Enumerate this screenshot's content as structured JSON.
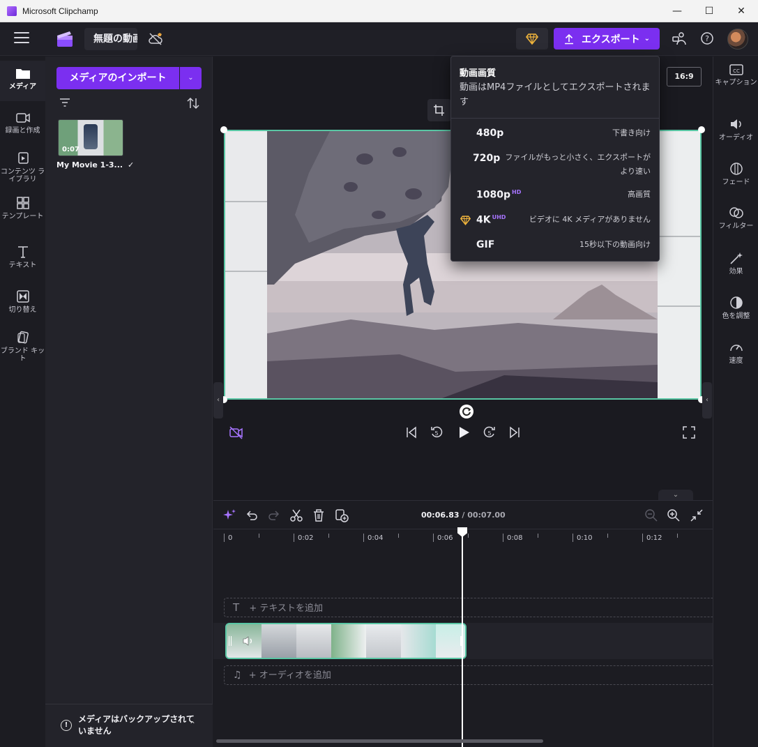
{
  "window": {
    "title": "Microsoft Clipchamp",
    "minimize": "—",
    "maximize": "☐",
    "close": "✕"
  },
  "appbar": {
    "project_name": "無題の動画",
    "export_label": "エクスポート"
  },
  "left_rail": [
    {
      "name": "media",
      "label": "メディア"
    },
    {
      "name": "record",
      "label": "録画と作成"
    },
    {
      "name": "content-library",
      "label": "コンテンツ ライブラリ"
    },
    {
      "name": "templates",
      "label": "テンプレート"
    },
    {
      "name": "text",
      "label": "テキスト"
    },
    {
      "name": "transitions",
      "label": "切り替え"
    },
    {
      "name": "brand-kit",
      "label": "ブランド キット"
    }
  ],
  "media_panel": {
    "import_label": "メディアのインポート",
    "items": [
      {
        "name": "My Movie 1-3...",
        "duration": "0:07",
        "status": "✓"
      }
    ],
    "backup_notice": "メディアはバックアップされていません"
  },
  "preview": {
    "aspect_ratio": "16:9"
  },
  "right_rail": [
    {
      "name": "captions",
      "label": "キャプション"
    },
    {
      "name": "audio",
      "label": "オーディオ"
    },
    {
      "name": "fade",
      "label": "フェード"
    },
    {
      "name": "filters",
      "label": "フィルター"
    },
    {
      "name": "effects",
      "label": "効果"
    },
    {
      "name": "color",
      "label": "色を調整"
    },
    {
      "name": "speed",
      "label": "速度"
    }
  ],
  "export_menu": {
    "title": "動画画質",
    "subtitle": "動画はMP4ファイルとしてエクスポートされます",
    "options": [
      {
        "res": "480p",
        "badge": "",
        "desc": "下書き向け"
      },
      {
        "res": "720p",
        "badge": "",
        "desc": "ファイルがもっと小さく、エクスポートがより速い"
      },
      {
        "res": "1080p",
        "badge": "HD",
        "desc": "高画質"
      },
      {
        "res": "4K",
        "badge": "UHD",
        "desc": "ビデオに 4K メディアがありません"
      },
      {
        "res": "GIF",
        "badge": "",
        "desc": "15秒以下の動画向け"
      }
    ]
  },
  "timeline": {
    "current_time": "00:06.83",
    "separator": " / ",
    "total_time": "00:07.00",
    "ruler_labels": [
      "0",
      "0:02",
      "0:04",
      "0:06",
      "0:08",
      "0:10",
      "0:12"
    ],
    "add_text": "+ テキストを追加",
    "add_audio": "+ オーディオを追加"
  }
}
